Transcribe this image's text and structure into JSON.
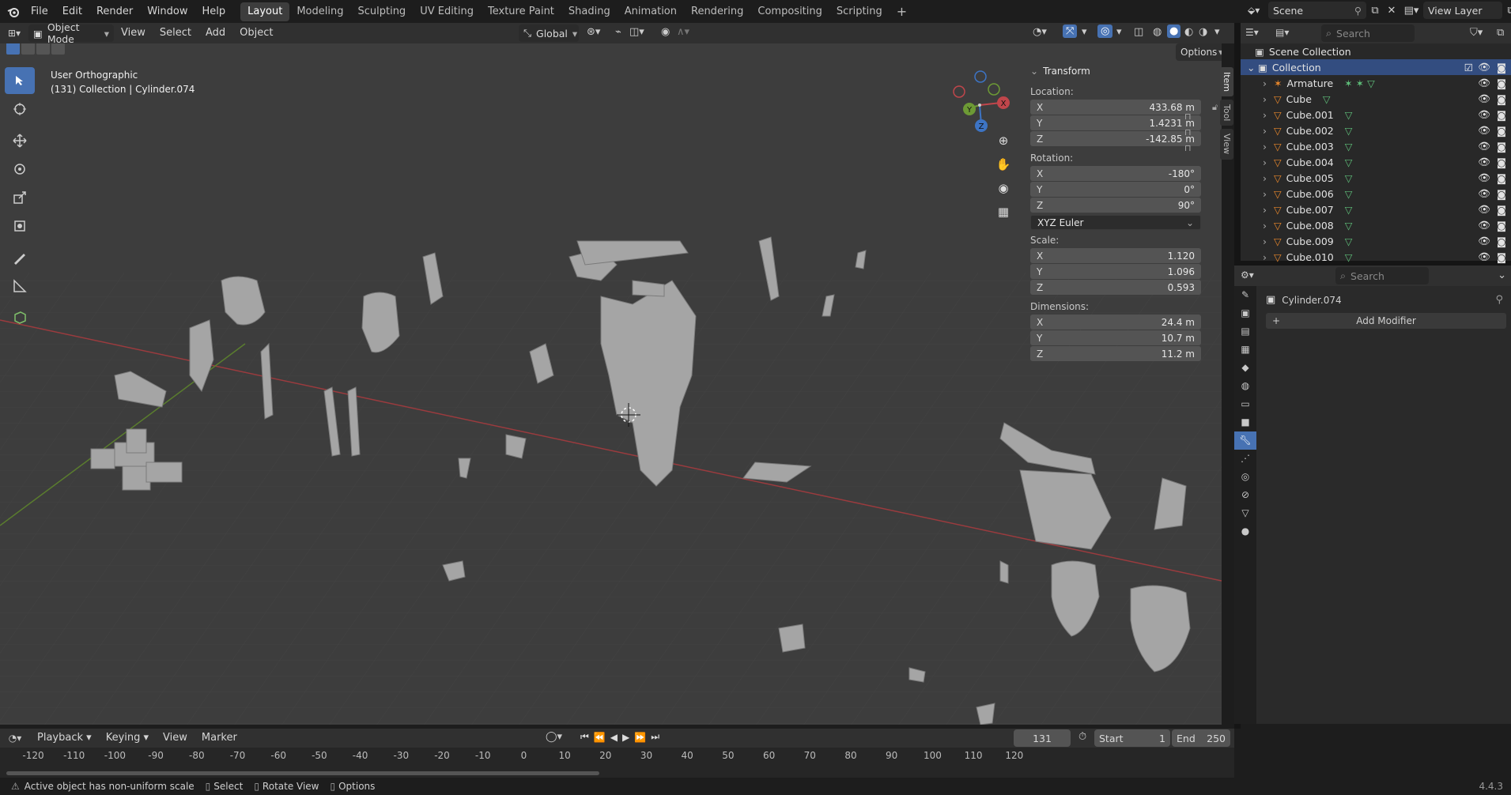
{
  "topbar": {
    "menus": [
      "File",
      "Edit",
      "Render",
      "Window",
      "Help"
    ],
    "workspaces": [
      "Layout",
      "Modeling",
      "Sculpting",
      "UV Editing",
      "Texture Paint",
      "Shading",
      "Animation",
      "Rendering",
      "Compositing",
      "Scripting"
    ],
    "active_workspace": "Layout",
    "scene": "Scene",
    "view_layer": "View Layer"
  },
  "viewport_header": {
    "mode": "Object Mode",
    "menus": [
      "View",
      "Select",
      "Add",
      "Object"
    ],
    "transform_orientation": "Global",
    "options": "Options"
  },
  "viewport": {
    "view_name": "User Orthographic",
    "info": "(131) Collection | Cylinder.074"
  },
  "gizmo": {
    "x": "X",
    "y": "Y",
    "z": "Z"
  },
  "npanel": {
    "title": "Transform",
    "location_label": "Location:",
    "location": {
      "x": "433.68 m",
      "y": "1.4231 m",
      "z": "-142.85 m"
    },
    "rotation_label": "Rotation:",
    "rotation": {
      "x": "-180°",
      "y": "0°",
      "z": "90°"
    },
    "rotation_mode": "XYZ Euler",
    "scale_label": "Scale:",
    "scale": {
      "x": "1.120",
      "y": "1.096",
      "z": "0.593"
    },
    "dimensions_label": "Dimensions:",
    "dimensions": {
      "x": "24.4 m",
      "y": "10.7 m",
      "z": "11.2 m"
    },
    "axes": [
      "X",
      "Y",
      "Z"
    ],
    "tabs": [
      "Item",
      "Tool",
      "View"
    ]
  },
  "outliner": {
    "search_placeholder": "Search",
    "scene_collection": "Scene Collection",
    "collection": "Collection",
    "items": [
      "Armature",
      "Cube",
      "Cube.001",
      "Cube.002",
      "Cube.003",
      "Cube.004",
      "Cube.005",
      "Cube.006",
      "Cube.007",
      "Cube.008",
      "Cube.009",
      "Cube.010"
    ]
  },
  "properties": {
    "search_placeholder": "Search",
    "object_name": "Cylinder.074",
    "add_modifier": "Add Modifier"
  },
  "timeline": {
    "menus": [
      "Playback",
      "Keying",
      "View",
      "Marker"
    ],
    "current_frame": "131",
    "start_label": "Start",
    "start": "1",
    "end_label": "End",
    "end": "250",
    "ticks": [
      "-120",
      "-110",
      "-100",
      "-90",
      "-80",
      "-70",
      "-60",
      "-50",
      "-40",
      "-30",
      "-20",
      "-10",
      "0",
      "10",
      "20",
      "30",
      "40",
      "50",
      "60",
      "70",
      "80",
      "90",
      "100",
      "110",
      "120"
    ]
  },
  "statusbar": {
    "message": "Active object has non-uniform scale",
    "select": "Select",
    "rotate": "Rotate View",
    "options": "Options",
    "version": "4.4.3"
  },
  "colors": {
    "accent": "#4772b3",
    "x_axis": "#c0464b",
    "y_axis": "#6d9a35",
    "z_axis": "#3d74c4",
    "mesh_icon": "#5fbf7a",
    "object_icon": "#e8872b"
  }
}
